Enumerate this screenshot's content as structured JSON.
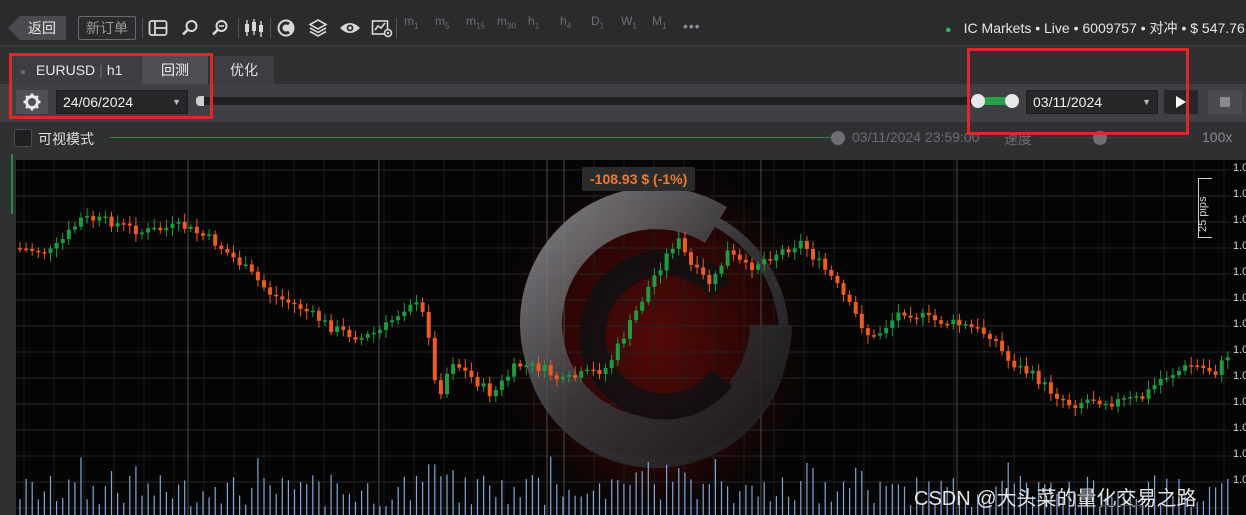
{
  "toolbar": {
    "back_label": "返回",
    "new_order_label": "新订单",
    "timeframes": [
      {
        "letter": "m",
        "num": "1"
      },
      {
        "letter": "m",
        "num": "5"
      },
      {
        "letter": "m",
        "num": "15"
      },
      {
        "letter": "m",
        "num": "30"
      },
      {
        "letter": "h",
        "num": "1"
      },
      {
        "letter": "h",
        "num": "4"
      },
      {
        "letter": "D",
        "num": "1"
      },
      {
        "letter": "W",
        "num": "1"
      },
      {
        "letter": "M",
        "num": "1"
      }
    ],
    "more": "•••",
    "icons": [
      "layout-icon",
      "zoom-in-icon",
      "zoom-out-icon",
      "candlestick-icon",
      "cbot-icon",
      "layers-icon",
      "eye-icon",
      "settings-chart-icon"
    ]
  },
  "account": {
    "text": "IC Markets • Live • 6009757 • 对冲 • $ 547.76",
    "status_color": "#31b05b"
  },
  "tabs": {
    "symbol": "EURUSD",
    "timeframe": "h1",
    "backtest": "回测",
    "optimize": "优化"
  },
  "controls": {
    "start_date": "24/06/2024",
    "end_date": "03/11/2024",
    "range_fill_color": "#27a24b"
  },
  "visual": {
    "label": "可视模式",
    "time": "03/11/2024 23:59:00",
    "speed_label": "速度",
    "speed_value": "100x"
  },
  "chart_overlay": {
    "pnl": "-108.93 $ (-1%)",
    "pips": "25 pips",
    "axis_label": "1.0",
    "up_color": "#1e9b3e",
    "down_color": "#ee5a24",
    "volume_color": "#7fa8d8"
  },
  "watermark": "CSDN @大头菜的量化交易之路"
}
